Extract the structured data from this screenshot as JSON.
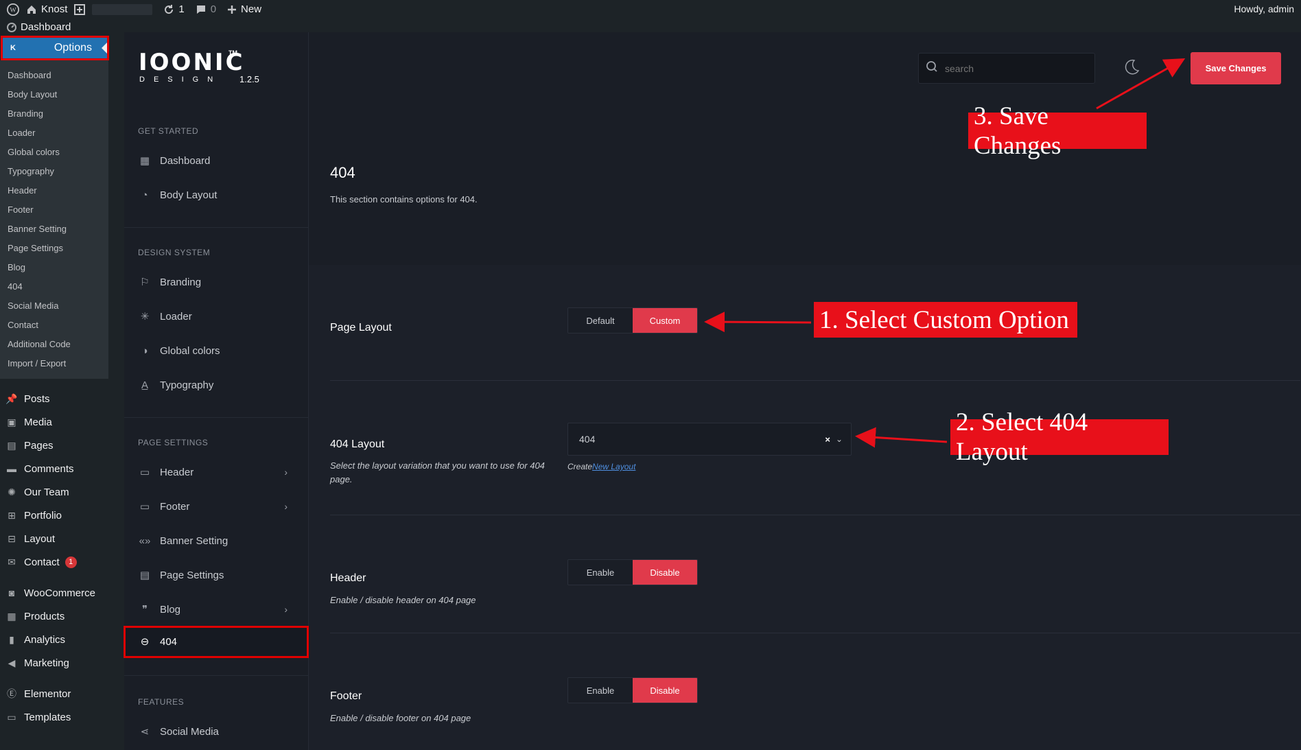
{
  "adminbar": {
    "site_name": "Knost",
    "updates": "1",
    "comments": "0",
    "new_label": "New",
    "howdy": "Howdy, admin"
  },
  "wpmenu": {
    "dashboard": "Dashboard",
    "options": "Options",
    "options_icon_letter": "K",
    "submenu": [
      "Dashboard",
      "Body Layout",
      "Branding",
      "Loader",
      "Global colors",
      "Typography",
      "Header",
      "Footer",
      "Banner Setting",
      "Page Settings",
      "Blog",
      "404",
      "Social Media",
      "Contact",
      "Additional Code",
      "Import / Export"
    ],
    "items": [
      {
        "label": "Posts",
        "icon": "pin-icon"
      },
      {
        "label": "Media",
        "icon": "media-icon"
      },
      {
        "label": "Pages",
        "icon": "pages-icon"
      },
      {
        "label": "Comments",
        "icon": "comment-icon"
      },
      {
        "label": "Our Team",
        "icon": "team-icon"
      },
      {
        "label": "Portfolio",
        "icon": "portfolio-icon"
      },
      {
        "label": "Layout",
        "icon": "layout-icon"
      },
      {
        "label": "Contact",
        "icon": "mail-icon",
        "badge": "1"
      },
      {
        "label": "WooCommerce",
        "icon": "woo-icon"
      },
      {
        "label": "Products",
        "icon": "products-icon"
      },
      {
        "label": "Analytics",
        "icon": "analytics-icon"
      },
      {
        "label": "Marketing",
        "icon": "marketing-icon"
      },
      {
        "label": "Elementor",
        "icon": "elementor-icon"
      },
      {
        "label": "Templates",
        "icon": "templates-icon"
      }
    ]
  },
  "plugin": {
    "logo_text": "IOONIC",
    "logo_tm": "TM",
    "logo_sub": "DESIGN",
    "version": "1.2.5",
    "search_placeholder": "search",
    "save_label": "Save Changes"
  },
  "sidebar": {
    "get_started": "GET STARTED",
    "design_system": "DESIGN SYSTEM",
    "page_settings": "PAGE SETTINGS",
    "features": "FEATURES",
    "items": {
      "dashboard": "Dashboard",
      "body_layout": "Body Layout",
      "branding": "Branding",
      "loader": "Loader",
      "global_colors": "Global colors",
      "typography": "Typography",
      "header": "Header",
      "footer": "Footer",
      "banner_setting": "Banner Setting",
      "page_settings": "Page Settings",
      "blog": "Blog",
      "p404": "404",
      "social_media": "Social Media"
    }
  },
  "main": {
    "title": "404",
    "description": "This section contains options for 404.",
    "page_layout": {
      "label": "Page Layout",
      "options": [
        "Default",
        "Custom"
      ],
      "selected": "Custom"
    },
    "layout_404": {
      "label": "404 Layout",
      "description": "Select the layout variation that you want to use for 404 page.",
      "value": "404",
      "clear": "×",
      "create_prefix": "Create",
      "create_link": "New Layout"
    },
    "header": {
      "label": "Header",
      "description": "Enable / disable header on 404 page",
      "options": [
        "Enable",
        "Disable"
      ],
      "selected": "Disable"
    },
    "footer": {
      "label": "Footer",
      "description": "Enable / disable footer on 404 page",
      "options": [
        "Enable",
        "Disable"
      ],
      "selected": "Disable"
    }
  },
  "annotations": {
    "step1": "1. Select Custom Option",
    "step2": "2. Select 404 Layout",
    "step3": "3. Save Changes"
  },
  "colors": {
    "accent": "#e03a4b",
    "annotation": "#e8101a",
    "wp_blue": "#2271b1"
  }
}
